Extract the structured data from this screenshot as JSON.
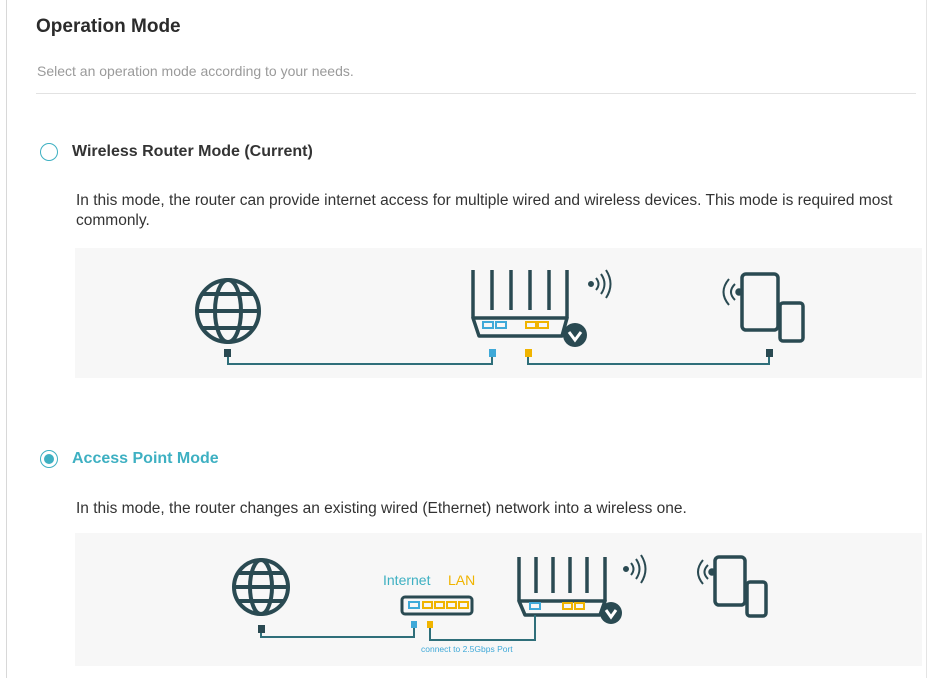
{
  "header": {
    "title": "Operation Mode",
    "subtitle": "Select an operation mode according to your needs."
  },
  "modes": [
    {
      "label": "Wireless Router Mode (Current)",
      "checked": false,
      "description": "In this mode, the router can provide internet access for multiple wired and wireless devices. This mode is required most commonly."
    },
    {
      "label": "Access Point Mode",
      "checked": true,
      "description": "In this mode, the router changes an existing wired (Ethernet) network into a wireless one.",
      "diagram": {
        "internet_label": "Internet",
        "lan_label": "LAN",
        "port_note": "connect to 2.5Gbps Port"
      }
    }
  ],
  "colors": {
    "accent": "#3eb0c2",
    "line": "#2f6f7a",
    "icon": "#2a4a52",
    "port_blue": "#3fa9d8",
    "port_yellow": "#f0b400",
    "lan_orange": "#f0b400"
  },
  "icons": [
    "globe-icon",
    "router-icon",
    "wifi-signal-icon",
    "devices-icon",
    "modem-icon"
  ]
}
